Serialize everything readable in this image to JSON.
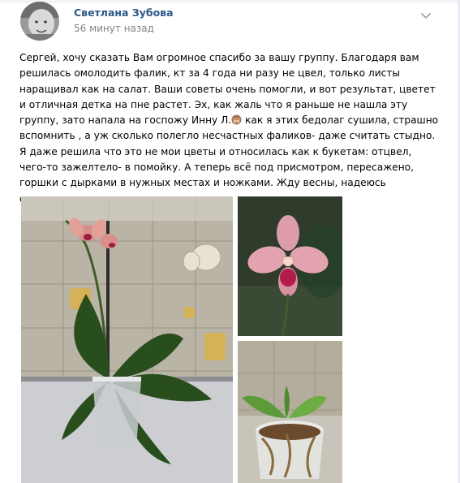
{
  "post": {
    "author": "Светлана Зубова",
    "time": "56 минут назад",
    "text_before_emoji": "Сергей, хочу сказать Вам огромное спасибо за вашу группу. Благодаря вам решилась омолодить фалик, кт за 4 года ни разу не цвел, только листы наращивал как на салат. Ваши советы очень помогли, и вот результат, цветет и отличная детка на пне растет. Эх, как жаль что я раньше не нашла эту группу, зато напала на госпожу Инну Л.",
    "text_after_emoji": " как я этих бедолаг сушила, страшно вспомнить , а уж сколько полегло несчастных фаликов- даже считать стыдно. Я даже решила что это не мои цветы и относилась как к букетам: отцвел, чего-то зажелтело- в помойку. А теперь всё под присмотром, пересажено, горшки с дырками в нужных местах и ножками. Жду весны, надеюсь остальные тоже порадуют цветоносами",
    "emoji": "see-no-evil-monkey-icon"
  },
  "colors": {
    "author": "#2a5885",
    "time": "#828282",
    "background": "#edeef0"
  }
}
